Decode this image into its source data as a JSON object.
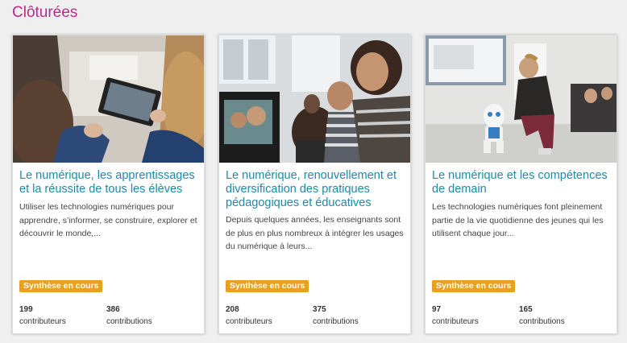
{
  "section": {
    "title": "Clôturées"
  },
  "cards": [
    {
      "title": "Le numérique, les apprentissages et la réussite de tous les élèves",
      "description": "Utiliser les technologies numériques pour apprendre, s’informer, se construire, explorer et découvrir le monde,...",
      "status": "Synthèse en cours",
      "contributors": {
        "count": "199",
        "label": "contributeurs"
      },
      "contributions": {
        "count": "386",
        "label": "contributions"
      }
    },
    {
      "title": "Le numérique, renouvellement et diversification des pratiques pédagogiques et éducatives",
      "description": "Depuis quelques années, les enseignants sont de plus en plus nombreux à intégrer les usages du numérique à leurs...",
      "status": "Synthèse en cours",
      "contributors": {
        "count": "208",
        "label": "contributeurs"
      },
      "contributions": {
        "count": "375",
        "label": "contributions"
      }
    },
    {
      "title": "Le numérique et les compétences de demain",
      "description": "Les technologies numériques font pleinement partie de la vie quotidienne des jeunes qui les utilisent chaque jour...",
      "status": "Synthèse en cours",
      "contributors": {
        "count": "97",
        "label": "contributeurs"
      },
      "contributions": {
        "count": "165",
        "label": "contributions"
      }
    }
  ],
  "colors": {
    "section_title": "#c0268e",
    "card_title": "#1e89a8",
    "status_badge": "#e8a020"
  },
  "icons": [
    "tablet-classroom-photo",
    "students-computer-photo",
    "robot-classroom-photo"
  ]
}
